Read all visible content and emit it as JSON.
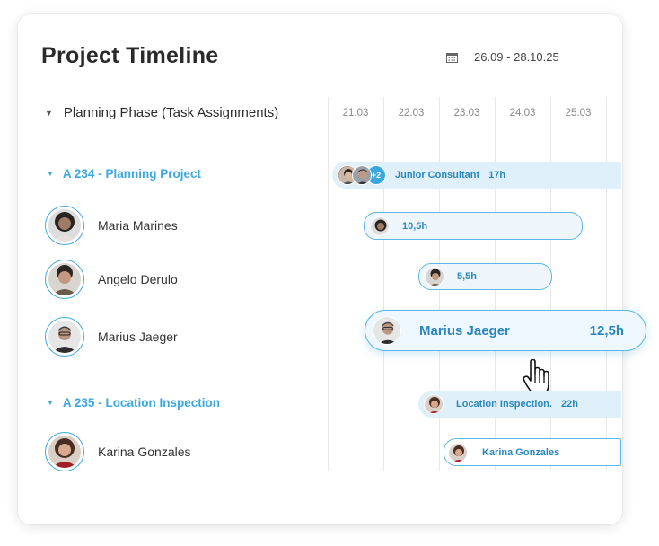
{
  "title": "Project Timeline",
  "date_range": "26.09 - 28.10.25",
  "phase": "Planning Phase (Task Assignments)",
  "dates": [
    "21.03",
    "22.03",
    "23.03",
    "24.03",
    "25.03"
  ],
  "projects": [
    {
      "name": "A 234 - Planning Project",
      "bar_role": "Junior Consultant",
      "bar_hours": "17h",
      "extra_count": "+2"
    },
    {
      "name": "A 235 - Location Inspection",
      "bar_role": "Location Inspection.",
      "bar_hours": "22h"
    }
  ],
  "people": [
    {
      "name": "Maria Marines",
      "hours": "10,5h"
    },
    {
      "name": "Angelo Derulo",
      "hours": "5,5h"
    },
    {
      "name": "Marius Jaeger",
      "hours": "12,5h"
    },
    {
      "name": "Karina Gonzales",
      "bar_label": "Karina Gonzales"
    }
  ],
  "popover": {
    "name": "Marius Jaeger",
    "hours": "12,5h"
  },
  "colors": {
    "accent": "#3aa7df",
    "bar_fill": "#dff0fa",
    "pill_fill": "#eef6fc"
  },
  "icons": {
    "calendar": "calendar-icon",
    "cursor": "hand-cursor-icon"
  }
}
